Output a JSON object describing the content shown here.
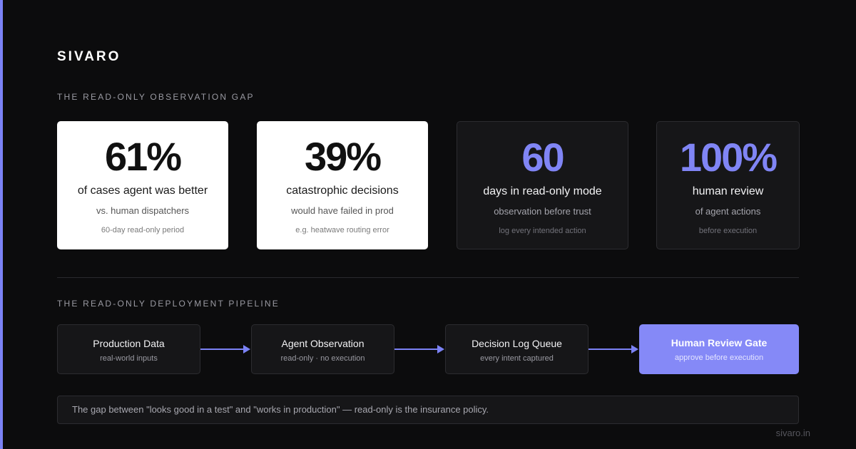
{
  "brand": "SIVARO",
  "gap_section": {
    "label": "THE READ-ONLY OBSERVATION GAP",
    "cards": [
      {
        "value": "61%",
        "title": "of cases agent was better",
        "subtitle": "vs. human dispatchers",
        "note": "60-day read-only period"
      },
      {
        "value": "39%",
        "title": "catastrophic decisions",
        "subtitle": "would have failed in prod",
        "note": "e.g. heatwave routing error"
      },
      {
        "value": "60",
        "title": "days in read-only mode",
        "subtitle": "observation before trust",
        "note": "log every intended action"
      },
      {
        "value": "100%",
        "title": "human review",
        "subtitle": "of agent actions",
        "note": "before execution"
      }
    ]
  },
  "pipeline_section": {
    "label": "THE READ-ONLY DEPLOYMENT PIPELINE",
    "steps": [
      {
        "label": "Production Data",
        "sub": "real-world inputs"
      },
      {
        "label": "Agent Observation",
        "sub": "read-only · no execution"
      },
      {
        "label": "Decision Log Queue",
        "sub": "every intent captured"
      },
      {
        "label": "Human Review Gate",
        "sub": "approve before execution"
      }
    ]
  },
  "footnote": "The gap between \"looks good in a test\" and \"works in production\" — read-only is the insurance policy.",
  "site": "sivaro.in",
  "colors": {
    "accent": "#8589f7",
    "background": "#0c0c0d",
    "card_dark": "#161618"
  }
}
